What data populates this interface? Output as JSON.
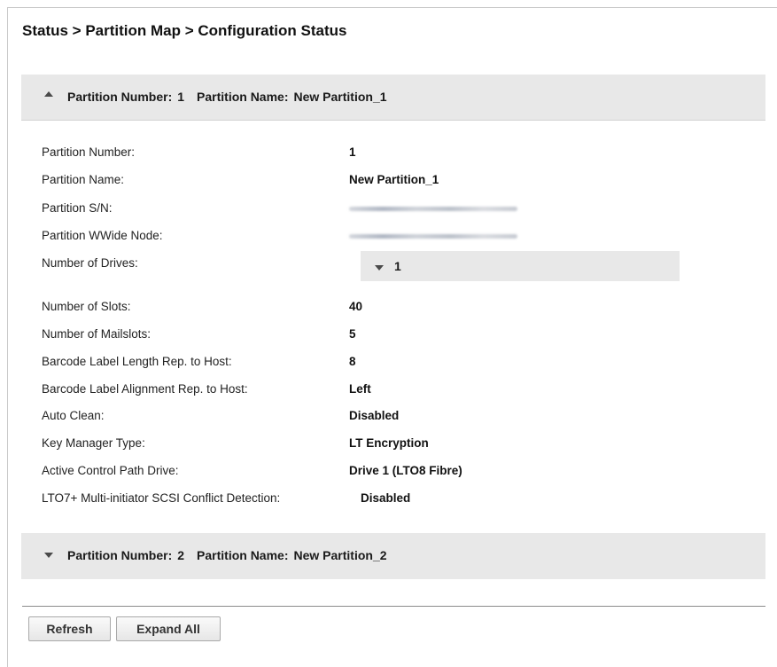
{
  "breadcrumb": "Status > Partition Map > Configuration Status",
  "partitions": [
    {
      "header": {
        "number_label": "Partition Number:",
        "number_value": "1",
        "name_label": "Partition Name:",
        "name_value": "New Partition_1",
        "expanded": true
      }
    },
    {
      "header": {
        "number_label": "Partition Number:",
        "number_value": "2",
        "name_label": "Partition Name:",
        "name_value": "New Partition_2",
        "expanded": false
      }
    }
  ],
  "details": {
    "partition_number": {
      "label": "Partition Number:",
      "value": "1"
    },
    "partition_name": {
      "label": "Partition Name:",
      "value": "New Partition_1"
    },
    "partition_sn": {
      "label": "Partition S/N:",
      "value_redacted": true
    },
    "partition_wwide_node": {
      "label": "Partition WWide Node:",
      "value_redacted": true
    },
    "number_of_drives": {
      "label": "Number of Drives:",
      "value": "1"
    },
    "number_of_slots": {
      "label": "Number of Slots:",
      "value": "40"
    },
    "number_of_mailslots": {
      "label": "Number of Mailslots:",
      "value": "5"
    },
    "barcode_length": {
      "label": "Barcode Label Length Rep. to Host:",
      "value": "8"
    },
    "barcode_alignment": {
      "label": "Barcode Label Alignment Rep. to Host:",
      "value": "Left"
    },
    "auto_clean": {
      "label": "Auto Clean:",
      "value": "Disabled"
    },
    "key_manager_type": {
      "label": "Key Manager Type:",
      "value": "LT Encryption"
    },
    "active_control_path": {
      "label": "Active Control Path Drive:",
      "value": "Drive 1 (LTO8 Fibre)"
    },
    "scsi_conflict": {
      "label": "LTO7+ Multi-initiator SCSI Conflict Detection:",
      "value": "Disabled"
    }
  },
  "buttons": {
    "refresh": "Refresh",
    "expand_all": "Expand All"
  }
}
